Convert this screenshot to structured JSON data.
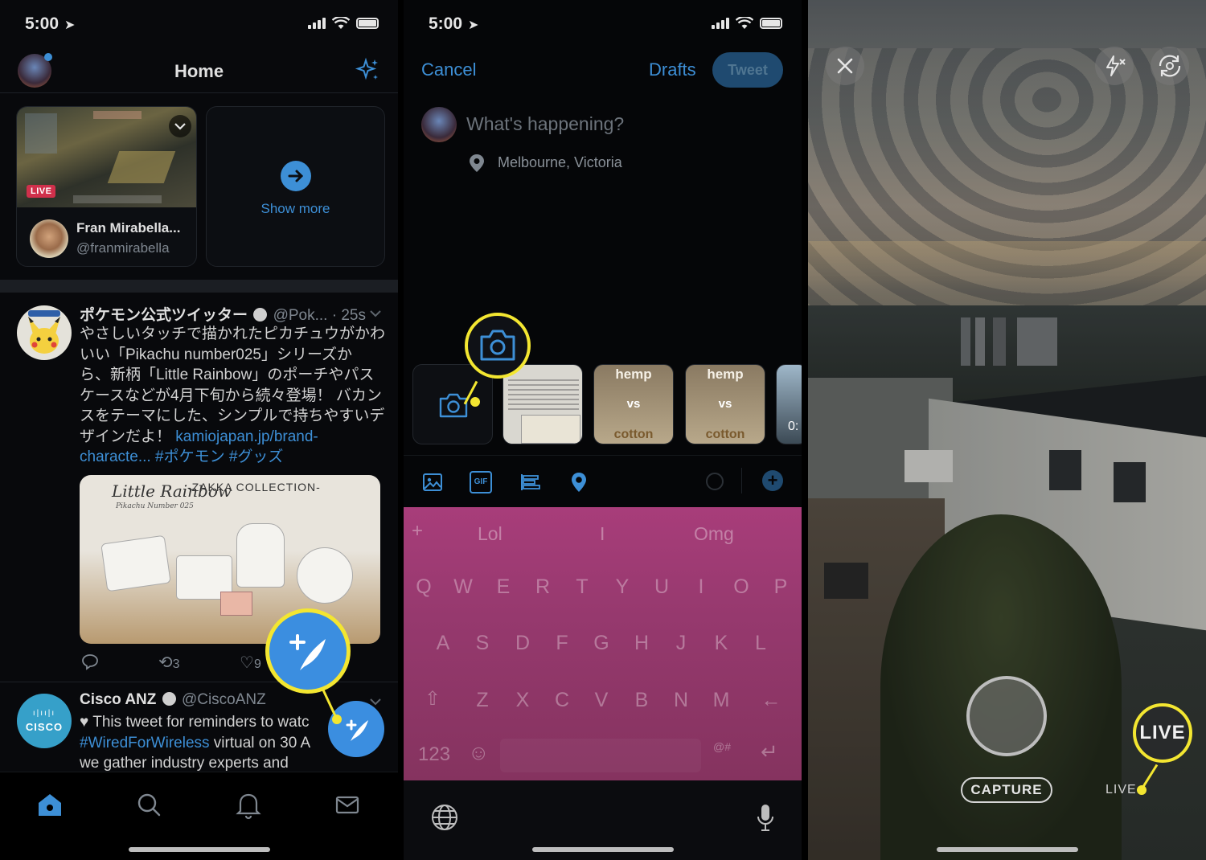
{
  "status_bar": {
    "time": "5:00"
  },
  "home": {
    "title": "Home",
    "live_card": {
      "badge": "LIVE",
      "user_name": "Fran Mirabella...",
      "user_handle": "@franmirabella"
    },
    "show_more": "Show more",
    "tweet1": {
      "name": "ポケモン公式ツイッター",
      "handle": "@Pok...",
      "time": "· 25s",
      "lines": [
        "やさしいタッチで描かれたピカチュウがかわ",
        "いい「Pikachu number025」シリーズか",
        "ら、新柄「Little Rainbow」のポーチやパス",
        "ケースなどが4月下旬から続々登場！ バカン",
        "スをテーマにした、シンプルで持ちやすいデ"
      ],
      "line6_text": "ザインだよ！",
      "link1": "kamiojapan.jp/brand-",
      "link2": "characte...",
      "hashtags": "#ポケモン #グッズ",
      "image_title_left": "Little Rainbow",
      "image_title_right": "-ZAKKA COLLECTION-",
      "image_sub": "Pikachu Number 025",
      "retweets": "3",
      "likes": "9"
    },
    "tweet2": {
      "name": "Cisco ANZ",
      "handle": "@CiscoANZ",
      "avatar_text": "CISCO",
      "line1": "♥ This tweet for reminders to watc",
      "hashtag": "#WiredForWireless",
      "line2_rest": " virtual on 30 A",
      "line3": "we gather industry experts and"
    }
  },
  "compose": {
    "cancel": "Cancel",
    "drafts": "Drafts",
    "tweet_button": "Tweet",
    "placeholder": "What's happening?",
    "location": "Melbourne, Victoria",
    "thumb_labels": {
      "top": "hemp",
      "mid": "vs",
      "bottom": "cotton",
      "last": "0:"
    },
    "gif_label": "GIF",
    "suggestions": [
      "Lol",
      "I",
      "Omg"
    ],
    "keyboard_rows": [
      [
        "Q",
        "W",
        "E",
        "R",
        "T",
        "Y",
        "U",
        "I",
        "O",
        "P"
      ],
      [
        "A",
        "S",
        "D",
        "F",
        "G",
        "H",
        "J",
        "K",
        "L"
      ],
      [
        "Z",
        "X",
        "C",
        "V",
        "B",
        "N",
        "M"
      ]
    ],
    "numbers_key": "123",
    "symbols_key": "@#"
  },
  "camera": {
    "capture_label": "CAPTURE",
    "live_label": "LIVE",
    "live_callout": "LIVE"
  },
  "colors": {
    "accent_blue": "#3d8fd6",
    "callout_yellow": "#f3e631",
    "fab_blue": "#3b8ee0",
    "keyboard_pink": "#a83d7a"
  }
}
